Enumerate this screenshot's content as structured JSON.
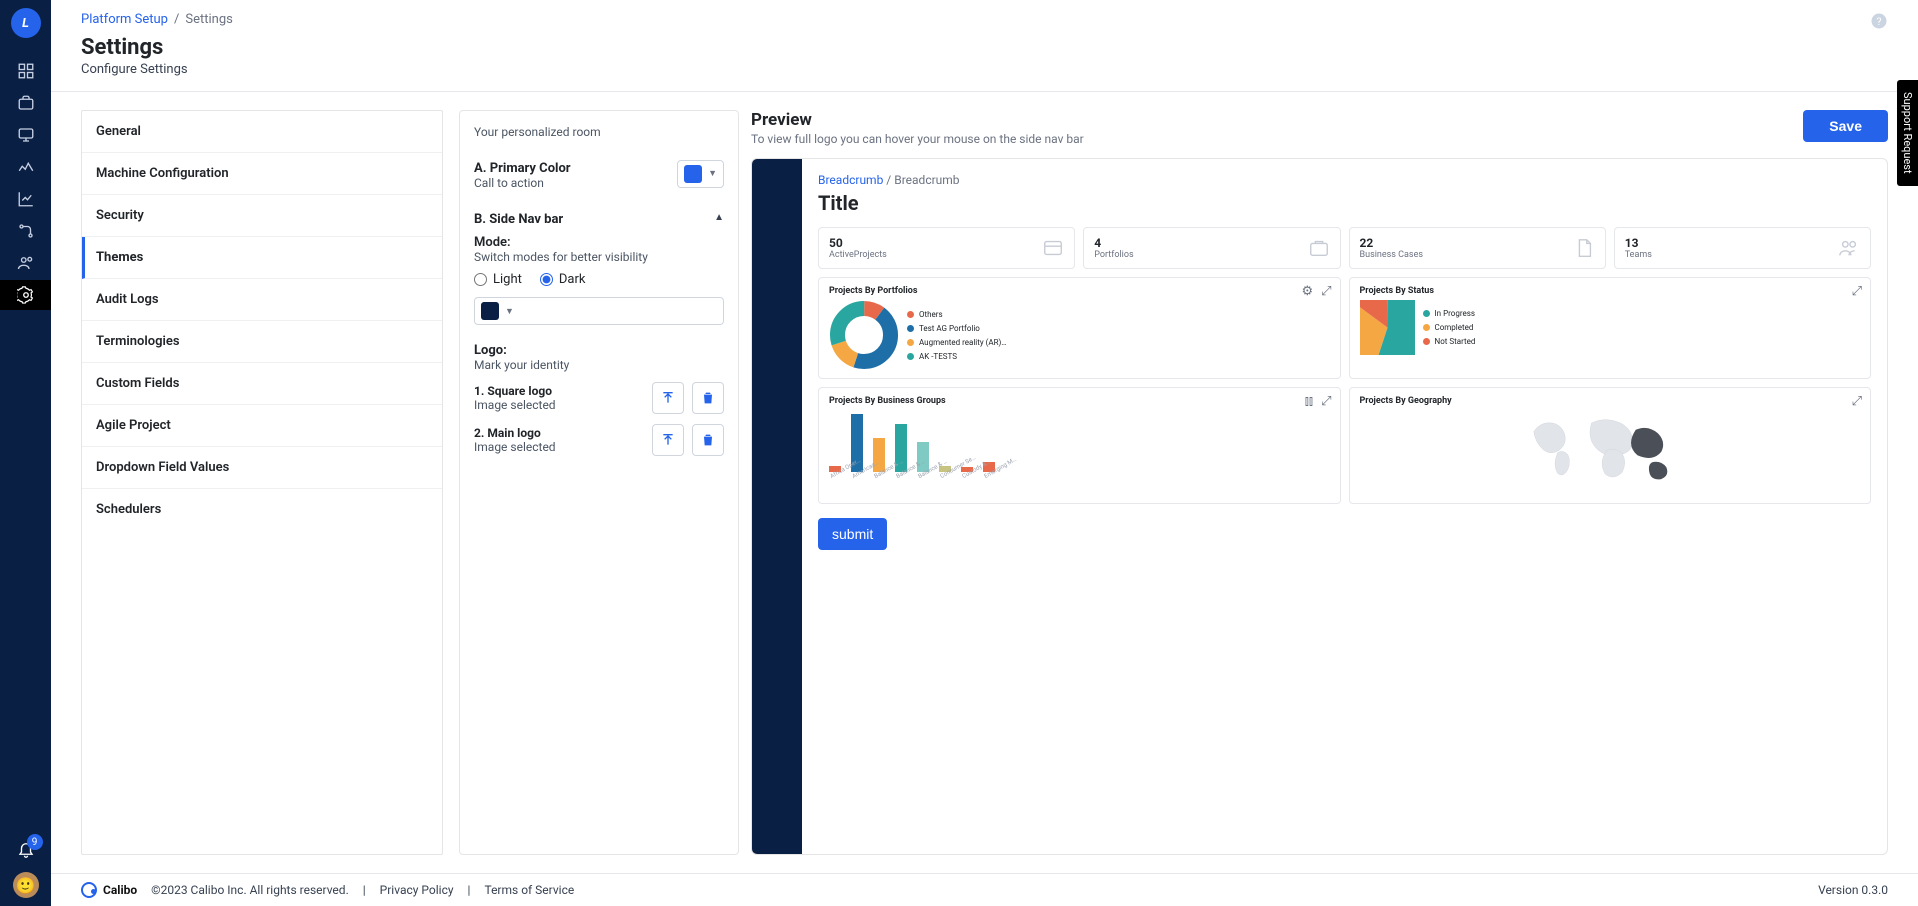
{
  "rail": {
    "logo_letter": "L",
    "notif_count": "9"
  },
  "breadcrumb": {
    "parent": "Platform Setup",
    "current": "Settings"
  },
  "page": {
    "title": "Settings",
    "subtitle": "Configure Settings"
  },
  "settings_tabs": [
    "General",
    "Machine Configuration",
    "Security",
    "Themes",
    "Audit Logs",
    "Terminologies",
    "Custom Fields",
    "Agile Project",
    "Dropdown Field Values",
    "Schedulers"
  ],
  "active_tab": "Themes",
  "config": {
    "room": "Your personalized room",
    "primary": {
      "label": "A. Primary Color",
      "hint": "Call to action",
      "color": "#2563eb"
    },
    "sidenav": {
      "label": "B. Side Nav bar",
      "mode_label": "Mode:",
      "mode_hint": "Switch modes for better visibility",
      "light": "Light",
      "dark": "Dark",
      "selected": "dark",
      "color": "#0a1f44"
    },
    "logo": {
      "label": "Logo:",
      "hint": "Mark your identity",
      "square": {
        "label": "1. Square logo",
        "status": "Image selected"
      },
      "main": {
        "label": "2. Main logo",
        "status": "Image selected"
      }
    }
  },
  "preview": {
    "title": "Preview",
    "hint": "To view full logo you can hover your mouse on the side nav bar",
    "save": "Save",
    "breadcrumb_link": "Breadcrumb",
    "breadcrumb_current": "Breadcrumb",
    "page_title": "Title",
    "cards": [
      {
        "n": "50",
        "t": "ActiveProjects"
      },
      {
        "n": "4",
        "t": "Portfolios"
      },
      {
        "n": "22",
        "t": "Business Cases"
      },
      {
        "n": "13",
        "t": "Teams"
      }
    ],
    "panel1": {
      "title": "Projects By Portfolios",
      "legend": [
        "Others",
        "Test AG Portfolio",
        "Augmented reality (AR)…",
        "AK -TESTS"
      ],
      "colors": [
        "#e8694a",
        "#1e6ea7",
        "#f4a742",
        "#2aa6a0"
      ]
    },
    "panel2": {
      "title": "Projects By Status",
      "legend": [
        "In Progress",
        "Completed",
        "Not Started"
      ],
      "colors": [
        "#2aa6a0",
        "#f4a742",
        "#e8694a"
      ]
    },
    "panel3": {
      "title": "Projects By Business Groups"
    },
    "panel4": {
      "title": "Projects By Geography"
    },
    "submit": "submit"
  },
  "chart_data": [
    {
      "type": "pie",
      "title": "Projects By Portfolios",
      "series": [
        {
          "name": "Others",
          "value": 10
        },
        {
          "name": "Test AG Portfolio",
          "value": 45
        },
        {
          "name": "Augmented reality (AR)…",
          "value": 15
        },
        {
          "name": "AK -TESTS",
          "value": 30
        }
      ],
      "colors": [
        "#e8694a",
        "#1e6ea7",
        "#f4a742",
        "#2aa6a0"
      ],
      "donut": true
    },
    {
      "type": "pie",
      "title": "Projects By Status",
      "series": [
        {
          "name": "In Progress",
          "value": 55
        },
        {
          "name": "Completed",
          "value": 30
        },
        {
          "name": "Not Started",
          "value": 15
        }
      ],
      "colors": [
        "#2aa6a0",
        "#f4a742",
        "#e8694a"
      ]
    },
    {
      "type": "bar",
      "title": "Projects By Business Groups",
      "categories": [
        "Africa Oper…",
        "Americas…",
        "Balance & …",
        "Balance & …",
        "Balance & …",
        "Consumer Se…",
        "Custody &…",
        "Emerging M…"
      ],
      "values": [
        5,
        48,
        28,
        40,
        25,
        5,
        4,
        8
      ],
      "colors": [
        "#e8694a",
        "#1e6ea7",
        "#f4a742",
        "#2aa6a0",
        "#7fcac3",
        "#c7c380",
        "#e8694a",
        "#e8694a"
      ],
      "ylim": [
        0,
        50
      ]
    }
  ],
  "footer": {
    "brand": "Calibo",
    "copy": "©2023 Calibo Inc. All rights reserved.",
    "privacy": "Privacy Policy",
    "terms": "Terms of Service",
    "version": "Version 0.3.0"
  },
  "support": "Support Request"
}
